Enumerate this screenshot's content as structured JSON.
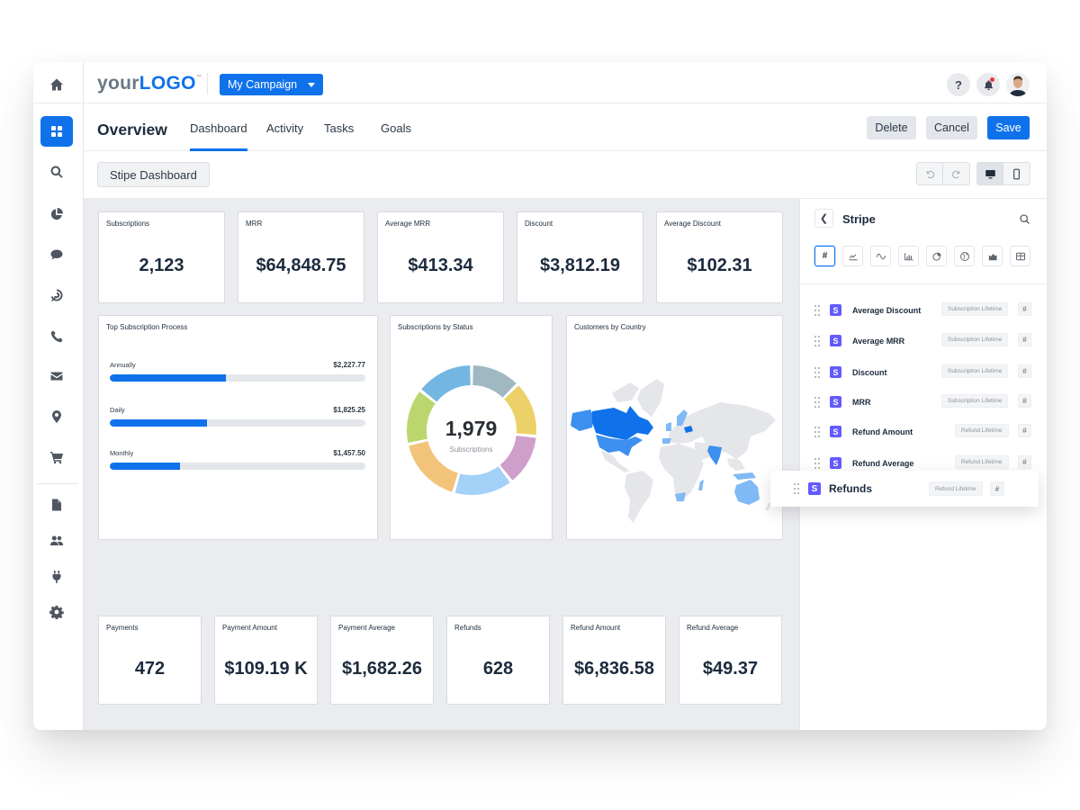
{
  "header": {
    "logo_your": "your",
    "logo_logo": "LOGO",
    "logo_tm": "™",
    "campaign_label": "My Campaign",
    "help_label": "?",
    "colors": {
      "accent": "#0f72ea",
      "stripe": "#635bff"
    }
  },
  "nav": {
    "page_title": "Overview",
    "tabs": [
      {
        "label": "Dashboard",
        "active": true
      },
      {
        "label": "Activity",
        "active": false
      },
      {
        "label": "Tasks",
        "active": false
      },
      {
        "label": "Goals",
        "active": false
      }
    ],
    "delete_label": "Delete",
    "cancel_label": "Cancel",
    "save_label": "Save"
  },
  "toolbar": {
    "dashboard_name": "Stipe Dashboard"
  },
  "sidebar": {
    "items": [
      {
        "icon": "home-icon"
      },
      {
        "icon": "dashboard-grid-icon",
        "active": true
      },
      {
        "icon": "search-icon"
      },
      {
        "icon": "pie-chart-icon"
      },
      {
        "icon": "chat-icon"
      },
      {
        "icon": "target-icon"
      },
      {
        "icon": "phone-icon"
      },
      {
        "icon": "mail-icon"
      },
      {
        "icon": "location-pin-icon"
      },
      {
        "icon": "cart-icon"
      },
      {
        "icon": "document-icon"
      },
      {
        "icon": "users-icon"
      },
      {
        "icon": "plug-icon"
      },
      {
        "icon": "settings-gear-icon"
      }
    ]
  },
  "kpis_top": [
    {
      "title": "Subscriptions",
      "value": "2,123"
    },
    {
      "title": "MRR",
      "value": "$64,848.75"
    },
    {
      "title": "Average MRR",
      "value": "$413.34"
    },
    {
      "title": "Discount",
      "value": "$3,812.19"
    },
    {
      "title": "Average Discount",
      "value": "$102.31"
    }
  ],
  "kpis_bottom": [
    {
      "title": "Payments",
      "value": "472"
    },
    {
      "title": "Payment Amount",
      "value": "$109.19 K"
    },
    {
      "title": "Payment Average",
      "value": "$1,682.26"
    },
    {
      "title": "Refunds",
      "value": "628"
    },
    {
      "title": "Refund Amount",
      "value": "$6,836.58"
    },
    {
      "title": "Refund Average",
      "value": "$49.37"
    }
  ],
  "top_process": {
    "title": "Top Subscription Process",
    "rows": [
      {
        "label": "Annually",
        "value": "$2,227.77",
        "fill": 0.455
      },
      {
        "label": "Daily",
        "value": "$1,825.25",
        "fill": 0.38
      },
      {
        "label": "Monthly",
        "value": "$1,457.50",
        "fill": 0.275
      }
    ]
  },
  "status_donut": {
    "title": "Subscriptions by Status",
    "center_value": "1,979",
    "center_label": "Subscriptions",
    "segments": [
      {
        "color": "#9fb8c2",
        "share": 0.125
      },
      {
        "color": "#ebd167",
        "share": 0.14
      },
      {
        "color": "#cf9fcb",
        "share": 0.13
      },
      {
        "color": "#a3d1f7",
        "share": 0.15
      },
      {
        "color": "#f2c47a",
        "share": 0.17
      },
      {
        "color": "#bcd66e",
        "share": 0.14
      },
      {
        "color": "#74b6e2",
        "share": 0.145
      }
    ]
  },
  "country_map": {
    "title": "Customers by Country",
    "highlighted": [
      {
        "country": "Canada",
        "level": "high"
      },
      {
        "country": "United States",
        "level": "medium"
      },
      {
        "country": "Alaska",
        "level": "medium"
      },
      {
        "country": "India",
        "level": "medium"
      },
      {
        "country": "Poland",
        "level": "high"
      },
      {
        "country": "Australia",
        "level": "low"
      },
      {
        "country": "Norway",
        "level": "low"
      },
      {
        "country": "United Kingdom",
        "level": "low"
      },
      {
        "country": "South Africa",
        "level": "low"
      }
    ],
    "colors": {
      "high": "#0f72ea",
      "medium": "#3d8ff0",
      "low": "#80b9f5",
      "none": "#e4e6ea"
    }
  },
  "panel": {
    "title": "Stripe",
    "viz_types": [
      {
        "icon": "number-hash-icon",
        "label": "#",
        "active": true
      },
      {
        "icon": "line-chart-icon"
      },
      {
        "icon": "sparkline-icon"
      },
      {
        "icon": "bar-chart-icon"
      },
      {
        "icon": "pie-chart-icon"
      },
      {
        "icon": "globe-icon"
      },
      {
        "icon": "area-chart-icon"
      },
      {
        "icon": "table-icon"
      }
    ],
    "metrics": [
      {
        "name": "Average Discount",
        "tag": "Subscription Lifetime",
        "type": "#"
      },
      {
        "name": "Average MRR",
        "tag": "Subscription Lifetime",
        "type": "#"
      },
      {
        "name": "Discount",
        "tag": "Subscription Lifetime",
        "type": "#"
      },
      {
        "name": "MRR",
        "tag": "Subscription Lifetime",
        "type": "#"
      },
      {
        "name": "Refund Amount",
        "tag": "Refund Lifetime",
        "type": "#"
      },
      {
        "name": "Refund Average",
        "tag": "Refund Lifetime",
        "type": "#"
      }
    ],
    "dragging": {
      "name": "Refunds",
      "tag": "Refund Lifetime",
      "type": "#"
    },
    "stripe_letter": "S"
  }
}
